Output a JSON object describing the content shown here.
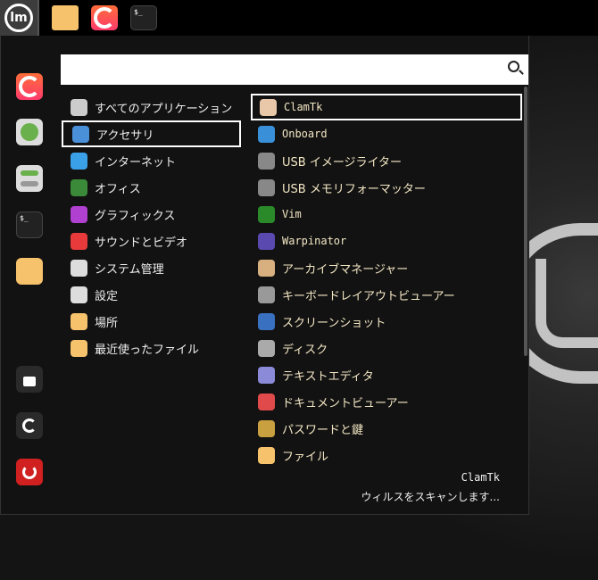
{
  "taskbar": {
    "apps": [
      "files",
      "firefox",
      "terminal"
    ],
    "terminal_glyph": "$_",
    "menu_logo": "lm"
  },
  "sidebar": {
    "items": [
      "firefox",
      "software-manager",
      "system-settings",
      "terminal",
      "files",
      "lock-screen",
      "logout",
      "shutdown"
    ]
  },
  "search": {
    "value": "",
    "placeholder": ""
  },
  "categories": [
    {
      "label": "すべてのアプリケーション",
      "icon": "grid-icon",
      "color": "#cccccc"
    },
    {
      "label": "アクセサリ",
      "icon": "scissors-icon",
      "color": "#4a90d9"
    },
    {
      "label": "インターネット",
      "icon": "cloud-icon",
      "color": "#3aa0e8"
    },
    {
      "label": "オフィス",
      "icon": "office-icon",
      "color": "#3a8a3a"
    },
    {
      "label": "グラフィックス",
      "icon": "graphics-icon",
      "color": "#b040d0"
    },
    {
      "label": "サウンドとビデオ",
      "icon": "play-icon",
      "color": "#e83a3a"
    },
    {
      "label": "システム管理",
      "icon": "toggle-icon",
      "color": "#dddddd"
    },
    {
      "label": "設定",
      "icon": "settings-icon",
      "color": "#dddddd"
    },
    {
      "label": "場所",
      "icon": "folder-icon",
      "color": "#f6c26b"
    },
    {
      "label": "最近使ったファイル",
      "icon": "recent-folder-icon",
      "color": "#f6c26b"
    }
  ],
  "selected_category": 1,
  "apps": [
    {
      "label": "ClamTk",
      "icon": "clamtk-icon",
      "color": "#e8c8a8",
      "mono": true
    },
    {
      "label": "Onboard",
      "icon": "onboard-icon",
      "color": "#3a90d8",
      "mono": true
    },
    {
      "label": "USB イメージライター",
      "icon": "usb-icon",
      "color": "#888888",
      "mono": false
    },
    {
      "label": "USB メモリフォーマッター",
      "icon": "usb-icon",
      "color": "#888888",
      "mono": false
    },
    {
      "label": "Vim",
      "icon": "vim-icon",
      "color": "#2a8a2a",
      "mono": true
    },
    {
      "label": "Warpinator",
      "icon": "warpinator-icon",
      "color": "#5a4ab0",
      "mono": true
    },
    {
      "label": "アーカイブマネージャー",
      "icon": "archive-icon",
      "color": "#d8b080",
      "mono": false
    },
    {
      "label": "キーボードレイアウトビューアー",
      "icon": "keyboard-icon",
      "color": "#999999",
      "mono": false
    },
    {
      "label": "スクリーンショット",
      "icon": "camera-icon",
      "color": "#3a70c0",
      "mono": false
    },
    {
      "label": "ディスク",
      "icon": "disk-icon",
      "color": "#aaaaaa",
      "mono": false
    },
    {
      "label": "テキストエディタ",
      "icon": "text-editor-icon",
      "color": "#8a8ad8",
      "mono": false
    },
    {
      "label": "ドキュメントビューアー",
      "icon": "document-viewer-icon",
      "color": "#e04a4a",
      "mono": false
    },
    {
      "label": "パスワードと鍵",
      "icon": "key-icon",
      "color": "#c8a040",
      "mono": false
    },
    {
      "label": "ファイル",
      "icon": "folder-icon",
      "color": "#f6c26b",
      "mono": false
    }
  ],
  "selected_app": 0,
  "description": {
    "title": "ClamTk",
    "text": "ウィルスをスキャンします..."
  }
}
